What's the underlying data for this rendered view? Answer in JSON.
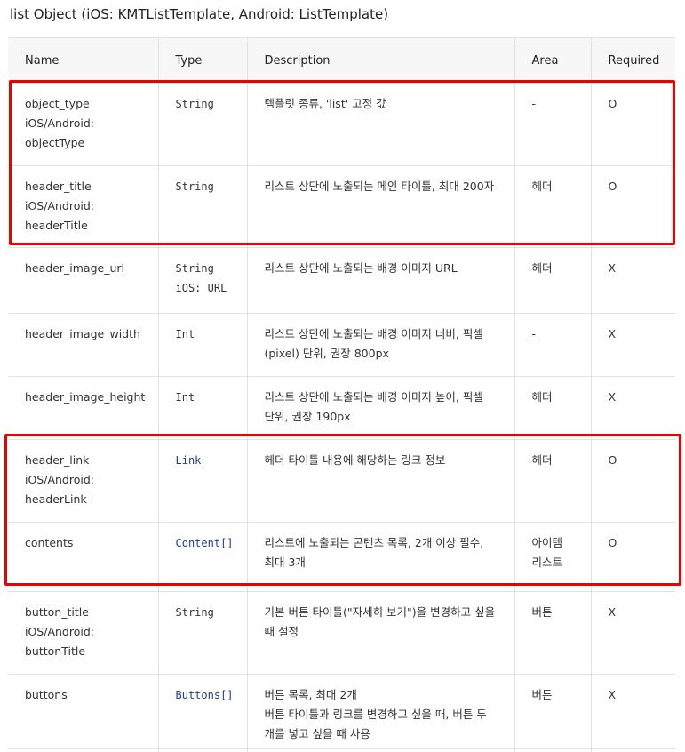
{
  "page": {
    "title": "list Object (iOS: KMTListTemplate, Android: ListTemplate)"
  },
  "table": {
    "headers": [
      "Name",
      "Type",
      "Description",
      "Area",
      "Required"
    ],
    "rows": [
      {
        "name": [
          "object_type",
          "iOS/Android:",
          "objectType"
        ],
        "type": [
          "String"
        ],
        "type_is_link": false,
        "description": [
          "템플릿 종류, 'list' 고정 값"
        ],
        "area": [
          "-"
        ],
        "required": "O"
      },
      {
        "name": [
          "header_title",
          "iOS/Android:",
          "headerTitle"
        ],
        "type": [
          "String"
        ],
        "type_is_link": false,
        "description": [
          "리스트 상단에 노출되는 메인 타이틀, 최대 200자"
        ],
        "area": [
          "헤더"
        ],
        "required": "O"
      },
      {
        "name": [
          "header_image_url"
        ],
        "type": [
          "String",
          "iOS: URL"
        ],
        "type_is_link": false,
        "description": [
          "리스트 상단에 노출되는 배경 이미지 URL"
        ],
        "area": [
          "헤더"
        ],
        "required": "X"
      },
      {
        "name": [
          "header_image_width"
        ],
        "type": [
          "Int"
        ],
        "type_is_link": false,
        "description": [
          "리스트 상단에 노출되는 배경 이미지 너비, 픽셀",
          "(pixel) 단위, 권장 800px"
        ],
        "area": [
          "-"
        ],
        "required": "X"
      },
      {
        "name": [
          "header_image_height"
        ],
        "type": [
          "Int"
        ],
        "type_is_link": false,
        "description": [
          "리스트 상단에 노출되는 배경 이미지 높이, 픽셀",
          "단위, 권장 190px"
        ],
        "area": [
          "헤더"
        ],
        "required": "X"
      },
      {
        "name": [
          "header_link",
          "iOS/Android:",
          "headerLink"
        ],
        "type": [
          "Link"
        ],
        "type_is_link": true,
        "description": [
          "헤더 타이틀 내용에 해당하는 링크 정보"
        ],
        "area": [
          "헤더"
        ],
        "required": "O"
      },
      {
        "name": [
          "contents"
        ],
        "type": [
          "Content[]"
        ],
        "type_is_link": true,
        "description": [
          "리스트에 노출되는 콘텐츠 목록, 2개 이상 필수,",
          "최대 3개"
        ],
        "area": [
          "아이템",
          "리스트"
        ],
        "required": "O"
      },
      {
        "name": [
          "button_title",
          "iOS/Android:",
          "buttonTitle"
        ],
        "type": [
          "String"
        ],
        "type_is_link": false,
        "description": [
          "기본 버튼 타이틀(\"자세히 보기\")을 변경하고 싶을",
          "때 설정"
        ],
        "area": [
          "버튼"
        ],
        "required": "X"
      },
      {
        "name": [
          "buttons"
        ],
        "type": [
          "Buttons[]"
        ],
        "type_is_link": true,
        "description": [
          "버튼 목록, 최대 2개",
          "버튼 타이틀과 링크를 변경하고 싶을 때, 버튼 두",
          "개를 넣고 싶을 때 사용"
        ],
        "area": [
          "버튼"
        ],
        "required": "X"
      }
    ]
  },
  "highlight_color": "#ee0000",
  "link_color": "#1e3d8f"
}
